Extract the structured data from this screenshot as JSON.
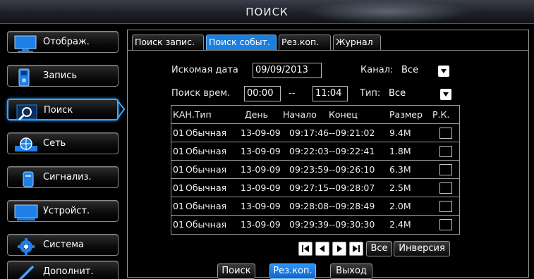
{
  "window": {
    "title": "ПОИСК"
  },
  "sidebar": {
    "items": [
      {
        "label": "Отображ.",
        "icon": "monitor-icon"
      },
      {
        "label": "Запись",
        "icon": "record-icon"
      },
      {
        "label": "Поиск",
        "icon": "search-icon",
        "active": true
      },
      {
        "label": "Сеть",
        "icon": "network-icon"
      },
      {
        "label": "Сигнализ.",
        "icon": "alarm-icon"
      },
      {
        "label": "Устройст.",
        "icon": "device-icon"
      },
      {
        "label": "Система",
        "icon": "system-gear-icon"
      },
      {
        "label": "Дополнит.",
        "icon": "advanced-icon"
      }
    ]
  },
  "tabs": [
    {
      "label": "Поиск запис."
    },
    {
      "label": "Поиск событ.",
      "active": true
    },
    {
      "label": "Рез.коп."
    },
    {
      "label": "Журнал"
    }
  ],
  "search": {
    "date_label": "Искомая дата",
    "date_value": "09/09/2013",
    "channel_label": "Канал:",
    "channel_value": "Все",
    "time_label": "Поиск врем.",
    "time_from": "00:00",
    "time_sep": "--",
    "time_to": "11:04",
    "type_label": "Тип:",
    "type_value": "Все"
  },
  "table": {
    "headers": {
      "ch_type": "КАН.Тип",
      "day": "День",
      "start": "Начало",
      "end": "Конец",
      "size": "Размер",
      "rk": "Р.К."
    },
    "rows": [
      {
        "ch": "01",
        "type": "Обычная",
        "day": "13-09-09",
        "range": "09:17:46--09:21:02",
        "size": "9.4M"
      },
      {
        "ch": "01",
        "type": "Обычная",
        "day": "13-09-09",
        "range": "09:22:03--09:22:41",
        "size": "1.8M"
      },
      {
        "ch": "01",
        "type": "Обычная",
        "day": "13-09-09",
        "range": "09:23:59--09:26:10",
        "size": "6.3M"
      },
      {
        "ch": "01",
        "type": "Обычная",
        "day": "13-09-09",
        "range": "09:27:15--09:28:07",
        "size": "2.5M"
      },
      {
        "ch": "01",
        "type": "Обычная",
        "day": "13-09-09",
        "range": "09:28:08--09:28:49",
        "size": "2.0M"
      },
      {
        "ch": "01",
        "type": "Обычная",
        "day": "13-09-09",
        "range": "09:29:39--09:30:30",
        "size": "2.4M"
      }
    ]
  },
  "pager": {
    "all_label": "Все",
    "invert_label": "Инверсия"
  },
  "actions": {
    "search_label": "Поиск",
    "backup_label": "Рез.коп.",
    "exit_label": "Выход"
  },
  "colors": {
    "accent": "#1b7fe0",
    "active_border": "#39a7ff"
  }
}
